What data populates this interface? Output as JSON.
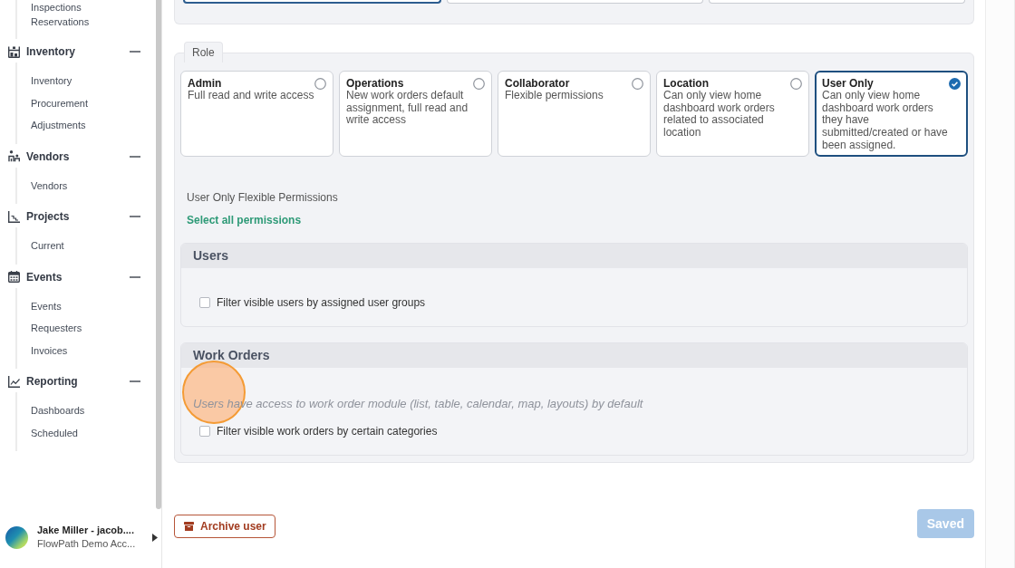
{
  "sidebar": {
    "groups": [
      {
        "items": [
          {
            "label": "Inspections"
          },
          {
            "label": "Reservations"
          }
        ]
      },
      {
        "label": "Inventory",
        "expanded": true,
        "items": [
          {
            "label": "Inventory"
          },
          {
            "label": "Procurement"
          },
          {
            "label": "Adjustments"
          }
        ]
      },
      {
        "label": "Vendors",
        "expanded": true,
        "items": [
          {
            "label": "Vendors"
          }
        ]
      },
      {
        "label": "Projects",
        "expanded": true,
        "items": [
          {
            "label": "Current"
          }
        ]
      },
      {
        "label": "Events",
        "expanded": true,
        "items": [
          {
            "label": "Events"
          },
          {
            "label": "Requesters"
          },
          {
            "label": "Invoices"
          }
        ]
      },
      {
        "label": "Reporting",
        "expanded": true,
        "items": [
          {
            "label": "Dashboards"
          },
          {
            "label": "Scheduled"
          }
        ]
      }
    ],
    "user": {
      "name": "Jake Miller - jacob....",
      "account": "FlowPath Demo Acc..."
    }
  },
  "top_fields": [
    {
      "focused": true
    },
    {
      "focused": false
    },
    {
      "focused": false
    }
  ],
  "role": {
    "legend": "Role",
    "options": [
      {
        "title": "Admin",
        "description": "Full read and write access",
        "selected": false
      },
      {
        "title": "Operations",
        "description": "New work orders default assignment, full read and write access",
        "selected": false
      },
      {
        "title": "Collaborator",
        "description": "Flexible permissions",
        "selected": false
      },
      {
        "title": "Location",
        "description": "Can only view home dashboard work orders related to associated location",
        "selected": false
      },
      {
        "title": "User Only",
        "description": "Can only view home dashboard work orders they have submitted/created or have been assigned.",
        "selected": true
      }
    ],
    "permissions_title": "User Only Flexible Permissions",
    "select_all": "Select all permissions",
    "sections": [
      {
        "title": "Users",
        "items": [
          {
            "kind": "checkbox",
            "label": "Filter visible users by assigned user groups",
            "checked": false
          }
        ]
      },
      {
        "title": "Work Orders",
        "items": [
          {
            "kind": "note",
            "text": "Users have access to work order module (list, table, calendar, map, layouts) by default"
          },
          {
            "kind": "checkbox",
            "label": "Filter visible work orders by certain categories",
            "checked": false
          }
        ]
      }
    ]
  },
  "click_marker": {
    "shown": true
  },
  "actions": {
    "archive": {
      "label": "Archive user"
    },
    "save": {
      "label": "Saved",
      "disabled": true
    }
  }
}
